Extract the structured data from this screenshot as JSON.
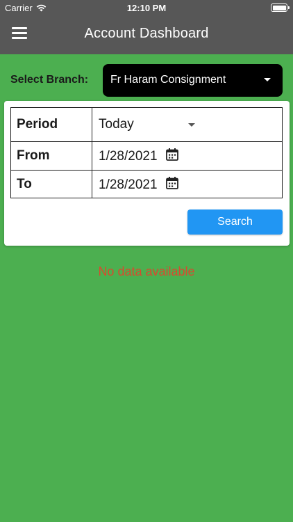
{
  "status_bar": {
    "carrier": "Carrier",
    "time": "12:10 PM"
  },
  "app_bar": {
    "title": "Account Dashboard"
  },
  "branch": {
    "label": "Select Branch:",
    "selected": "Fr Haram Consignment"
  },
  "filters": {
    "period_label": "Period",
    "period_value": "Today",
    "from_label": "From",
    "from_value": "1/28/2021",
    "to_label": "To",
    "to_value": "1/28/2021"
  },
  "search_button": "Search",
  "empty_message": "No data available",
  "colors": {
    "background": "#4CAF50",
    "app_bar": "#575757",
    "branch_select": "#000000",
    "search_button": "#2196F3",
    "empty_message": "#D84A2E"
  }
}
